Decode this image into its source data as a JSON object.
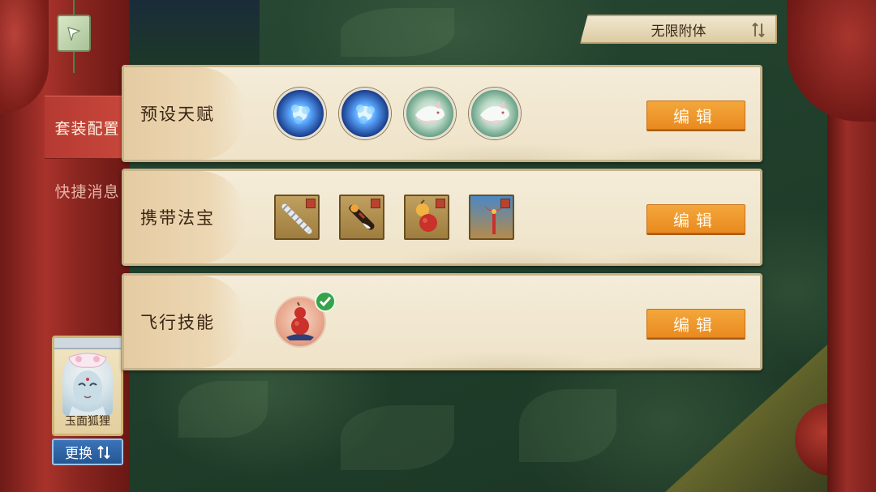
{
  "sidebar": {
    "tabs": [
      {
        "label": "套装配置",
        "active": true
      },
      {
        "label": "快捷消息",
        "active": false
      }
    ]
  },
  "character": {
    "name": "玉面狐狸",
    "swap_label": "更换",
    "swap_icon": "swap-vertical-icon"
  },
  "mode_select": {
    "value": "无限附体",
    "icon": "swap-vertical-icon"
  },
  "panels": [
    {
      "label": "预设天赋",
      "edit_label": "编辑",
      "slot_type": "talent",
      "slots": [
        "blue-spirit-orb-icon",
        "blue-spirit-orb-icon",
        "white-fox-spirit-icon",
        "white-fox-spirit-icon"
      ]
    },
    {
      "label": "携带法宝",
      "edit_label": "编辑",
      "slot_type": "treasure",
      "slots": [
        "silver-whip-icon",
        "fire-scroll-icon",
        "red-gourd-icon",
        "crescent-staff-icon"
      ]
    },
    {
      "label": "飞行技能",
      "edit_label": "编辑",
      "slot_type": "flight",
      "slots": [
        "flying-gourd-icon"
      ],
      "equipped": true
    }
  ],
  "colors": {
    "edit_button": "#f0992c",
    "active_tab": "#c0423a",
    "swap_button": "#2f66a8",
    "panel_bg": "#f2e8d2",
    "check": "#36a34a"
  }
}
